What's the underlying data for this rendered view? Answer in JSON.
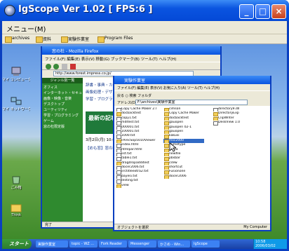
{
  "window": {
    "title": "IgScope Ver 1.02 [ FPS:6 ]",
    "minimize": "_",
    "maximize": "□",
    "close": "×"
  },
  "menu": {
    "items": [
      "メニュー(M)"
    ]
  },
  "desktop": {
    "toolbar_tabs": [
      "archives",
      "資料",
      "実験作業室",
      "Program Files"
    ],
    "icons": [
      {
        "label": "マイ コンピュータ",
        "icon": "computer-icon"
      },
      {
        "label": "マイ ネットワーク",
        "icon": "network-icon"
      },
      {
        "label": "ごみ箱",
        "icon": "recycle-bin-icon"
      },
      {
        "label": "Think",
        "icon": "folder-icon"
      }
    ]
  },
  "browser": {
    "title": "窓の杜 - Mozilla Firefox",
    "menu": "ファイル(F)  編集(E)  表示(V)  移動(G)  ブックマーク(B)  ツール(T)  ヘルプ(H)",
    "address": "http://www.forest.impress.co.jp/",
    "sidebar_header": "ジャンル別一覧",
    "sidebar_items": [
      "オフィス",
      "インターネット・セキュリティ",
      "画像・映像・音楽",
      "デスクトップ",
      "ユーティリティ",
      "学習・プログラミング",
      "ゲーム",
      "窓の杜限定版"
    ],
    "links": [
      "辞書・事典・カレンダー",
      "画像処理・デザイン",
      "学習・プログラミング"
    ],
    "banner": "最新の記事",
    "date": "3月2日(月) 10:00更新",
    "headline": "【めも窓】窓の杜PC版",
    "status": "完了"
  },
  "explorer": {
    "title": "実験作業室",
    "menu": "ファイル(F)  編集(E)  表示(V)  お気に入り(A)  ツール(T)  ヘルプ(H)",
    "toolbar": "戻る  ○  検索  フォルダ",
    "address_label": "アドレス(D)",
    "address": "F:\\archives\\実験作業室",
    "columns": [
      [
        "Copy Cache Maker 2.0",
        "docbacktest",
        "copy1.txt",
        "mdltest.txt",
        "000001.txt",
        "100001.txt",
        "1000.txt",
        "FArecSop5010Viewer",
        "index.html",
        "htmlpar.html",
        "list.txt",
        "table1.txt",
        "dragdropadditest",
        "docer2006.txt",
        "lirctitleextra2.txt",
        "bayesi.txt",
        "testing.txt",
        "view"
      ],
      [
        "cimson",
        "Copy Cache Maker",
        "docbacktest",
        "gauopen",
        "gauopen 02-1",
        "gauopen",
        "kakusi",
        "msc2000",
        "mimetype",
        "musa",
        "newfile",
        "pbsbar",
        "cs9w",
        "shortcut",
        "Fusionone",
        "docer2006"
      ],
      [
        "directory9.dll",
        "DirectoryExp",
        "ClipWriter",
        "DeskView 1.0",
        "",
        "",
        "",
        "",
        "",
        "",
        "",
        "",
        "",
        "",
        "",
        ""
      ]
    ],
    "selected_file": "msc2000",
    "status": "オブジェクトを選択",
    "status_right": "My Computer"
  },
  "taskbar": {
    "start": "スタート",
    "buttons": [
      "実験作業室",
      "topic - WZ ...",
      "Fork Reader",
      "Messenger",
      "かさめ - Win...",
      "IgScope"
    ],
    "time": "10:58",
    "date": "2006/03/02"
  }
}
